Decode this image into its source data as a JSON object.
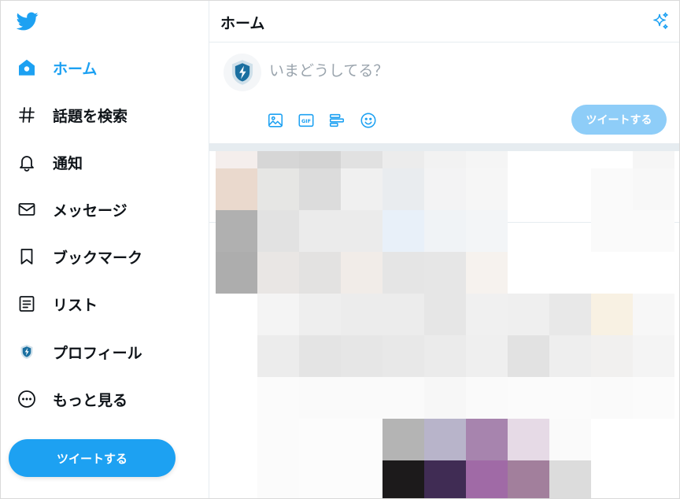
{
  "sidebar": {
    "logo": "twitter-bird-icon",
    "items": [
      {
        "label": "ホーム",
        "icon": "home-icon",
        "active": true
      },
      {
        "label": "話題を検索",
        "icon": "hashtag-icon",
        "active": false
      },
      {
        "label": "通知",
        "icon": "bell-icon",
        "active": false
      },
      {
        "label": "メッセージ",
        "icon": "envelope-icon",
        "active": false
      },
      {
        "label": "ブックマーク",
        "icon": "bookmark-icon",
        "active": false
      },
      {
        "label": "リスト",
        "icon": "list-icon",
        "active": false
      },
      {
        "label": "プロフィール",
        "icon": "profile-avatar-icon",
        "active": false
      },
      {
        "label": "もっと見る",
        "icon": "more-icon",
        "active": false
      }
    ],
    "tweet_button_label": "ツイートする"
  },
  "header": {
    "title": "ホーム",
    "sparkle_icon": "sparkle-icon"
  },
  "composer": {
    "placeholder": "いまどうしてる？",
    "tools": [
      "image-icon",
      "gif-icon",
      "poll-icon",
      "emoji-icon"
    ],
    "gif_text": "GIF",
    "submit_label": "ツイートする"
  },
  "colors": {
    "accent": "#1da1f2",
    "accent_disabled": "#8ecdf8",
    "text": "#0f1419",
    "placeholder": "#9aa4ad",
    "border": "#e6ecf0"
  },
  "feed": {
    "content": "pixelated-image (mosaic)"
  }
}
